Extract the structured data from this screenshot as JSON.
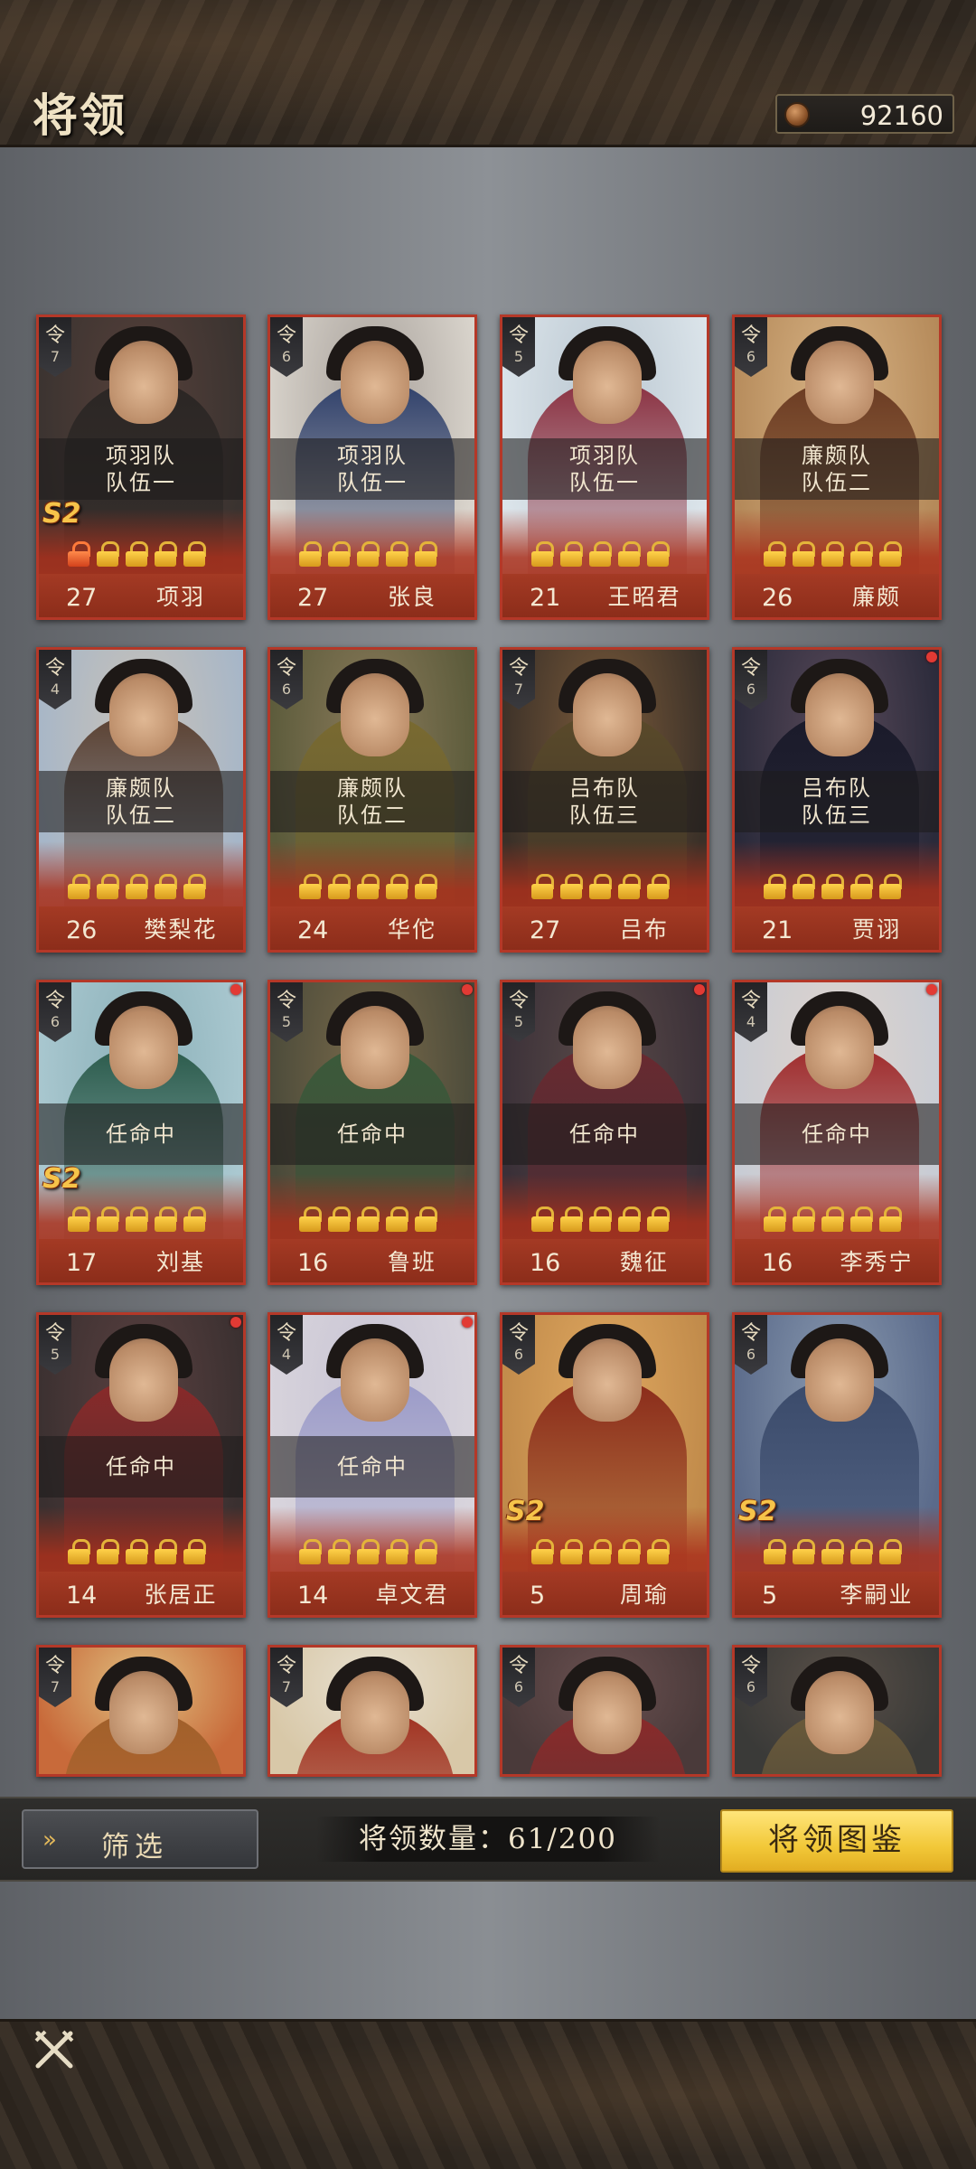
{
  "header": {
    "title": "将领",
    "currency_icon": "copper-coin-icon",
    "currency_value": "92160"
  },
  "generals": [
    {
      "rank_label": "令",
      "rank": "7",
      "status": [
        "项羽队",
        "队伍一"
      ],
      "level": "27",
      "name": "项羽",
      "s2": true,
      "dot": false,
      "red_locks": 1,
      "palette": [
        "#3a3330",
        "#2b2624",
        "#56403a"
      ]
    },
    {
      "rank_label": "令",
      "rank": "6",
      "status": [
        "项羽队",
        "队伍一"
      ],
      "level": "27",
      "name": "张良",
      "s2": false,
      "dot": false,
      "red_locks": 0,
      "palette": [
        "#d9d4cc",
        "#2e3f6a",
        "#a7a09a"
      ]
    },
    {
      "rank_label": "令",
      "rank": "5",
      "status": [
        "项羽队",
        "队伍一"
      ],
      "level": "21",
      "name": "王昭君",
      "s2": false,
      "dot": false,
      "red_locks": 0,
      "palette": [
        "#dbe4ea",
        "#8a3040",
        "#b9c6d0"
      ]
    },
    {
      "rank_label": "令",
      "rank": "6",
      "status": [
        "廉颇队",
        "队伍二"
      ],
      "level": "26",
      "name": "廉颇",
      "s2": false,
      "dot": false,
      "red_locks": 0,
      "palette": [
        "#b58a5a",
        "#6a3a22",
        "#d8b486"
      ]
    },
    {
      "rank_label": "令",
      "rank": "4",
      "status": [
        "廉颇队",
        "队伍二"
      ],
      "level": "26",
      "name": "樊梨花",
      "s2": false,
      "dot": false,
      "red_locks": 0,
      "palette": [
        "#a6b6c8",
        "#5a4030",
        "#c9c2b8"
      ]
    },
    {
      "rank_label": "令",
      "rank": "6",
      "status": [
        "廉颇队",
        "队伍二"
      ],
      "level": "24",
      "name": "华佗",
      "s2": false,
      "dot": false,
      "red_locks": 0,
      "palette": [
        "#5a5a3a",
        "#7a6a30",
        "#8a7a5a"
      ]
    },
    {
      "rank_label": "令",
      "rank": "7",
      "status": [
        "吕布队",
        "队伍三"
      ],
      "level": "27",
      "name": "吕布",
      "s2": false,
      "dot": false,
      "red_locks": 0,
      "palette": [
        "#3a3028",
        "#5a4a2a",
        "#7a5a3a"
      ]
    },
    {
      "rank_label": "令",
      "rank": "6",
      "status": [
        "吕布队",
        "队伍三"
      ],
      "level": "21",
      "name": "贾诩",
      "s2": false,
      "dot": true,
      "red_locks": 0,
      "palette": [
        "#2a2a3a",
        "#1a1a2a",
        "#5a4a5a"
      ]
    },
    {
      "rank_label": "令",
      "rank": "6",
      "status": [
        "任命中"
      ],
      "level": "17",
      "name": "刘基",
      "s2": true,
      "dot": true,
      "red_locks": 0,
      "palette": [
        "#aac8d0",
        "#2a5a4a",
        "#8ab0b8"
      ]
    },
    {
      "rank_label": "令",
      "rank": "5",
      "status": [
        "任命中"
      ],
      "level": "16",
      "name": "鲁班",
      "s2": false,
      "dot": true,
      "red_locks": 0,
      "palette": [
        "#4a4a3a",
        "#3a5a3a",
        "#7a6a4a"
      ]
    },
    {
      "rank_label": "令",
      "rank": "5",
      "status": [
        "任命中"
      ],
      "level": "16",
      "name": "魏征",
      "s2": false,
      "dot": true,
      "red_locks": 0,
      "palette": [
        "#3a3038",
        "#6a2a30",
        "#5a4a48"
      ]
    },
    {
      "rank_label": "令",
      "rank": "4",
      "status": [
        "任命中"
      ],
      "level": "16",
      "name": "李秀宁",
      "s2": false,
      "dot": true,
      "red_locks": 0,
      "palette": [
        "#c8ccd4",
        "#a02a2a",
        "#e0d4cc"
      ]
    },
    {
      "rank_label": "令",
      "rank": "5",
      "status": [
        "任命中"
      ],
      "level": "14",
      "name": "张居正",
      "s2": false,
      "dot": true,
      "red_locks": 0,
      "palette": [
        "#3a3030",
        "#8a2a2a",
        "#5a4040"
      ]
    },
    {
      "rank_label": "令",
      "rank": "4",
      "status": [
        "任命中"
      ],
      "level": "14",
      "name": "卓文君",
      "s2": false,
      "dot": true,
      "red_locks": 0,
      "palette": [
        "#d8d4dc",
        "#9a9ac8",
        "#c8c4d4"
      ]
    },
    {
      "rank_label": "令",
      "rank": "6",
      "status": [],
      "level": "5",
      "name": "周瑜",
      "s2": true,
      "dot": false,
      "red_locks": 0,
      "palette": [
        "#c08a4a",
        "#8a2a1a",
        "#e0a860"
      ]
    },
    {
      "rank_label": "令",
      "rank": "6",
      "status": [],
      "level": "5",
      "name": "李嗣业",
      "s2": true,
      "dot": false,
      "red_locks": 0,
      "palette": [
        "#5a6a8a",
        "#3a4a6a",
        "#8a9ab0"
      ]
    },
    {
      "rank_label": "令",
      "rank": "7",
      "status": [],
      "level": "",
      "name": "",
      "s2": false,
      "dot": false,
      "red_locks": 0,
      "palette": [
        "#c86a3a",
        "#a0602a",
        "#e0c080"
      ]
    },
    {
      "rank_label": "令",
      "rank": "7",
      "status": [],
      "level": "",
      "name": "",
      "s2": false,
      "dot": false,
      "red_locks": 0,
      "palette": [
        "#d8c8a8",
        "#a03020",
        "#e8e0d0"
      ]
    },
    {
      "rank_label": "令",
      "rank": "6",
      "status": [],
      "level": "",
      "name": "",
      "s2": false,
      "dot": false,
      "red_locks": 0,
      "palette": [
        "#4a3a3a",
        "#8a2a2a",
        "#6a5050"
      ]
    },
    {
      "rank_label": "令",
      "rank": "6",
      "status": [],
      "level": "",
      "name": "",
      "s2": false,
      "dot": false,
      "red_locks": 0,
      "palette": [
        "#3a3a38",
        "#6a5a3a",
        "#5a5048"
      ]
    }
  ],
  "badge_text": "S2",
  "bottom_bar": {
    "filter_label": "筛选",
    "filter_icon": "double-chevron-right-icon",
    "count_text": "将领数量：61/200",
    "codex_label": "将领图鉴"
  },
  "footer": {
    "close_icon": "crossed-swords-close-icon"
  }
}
